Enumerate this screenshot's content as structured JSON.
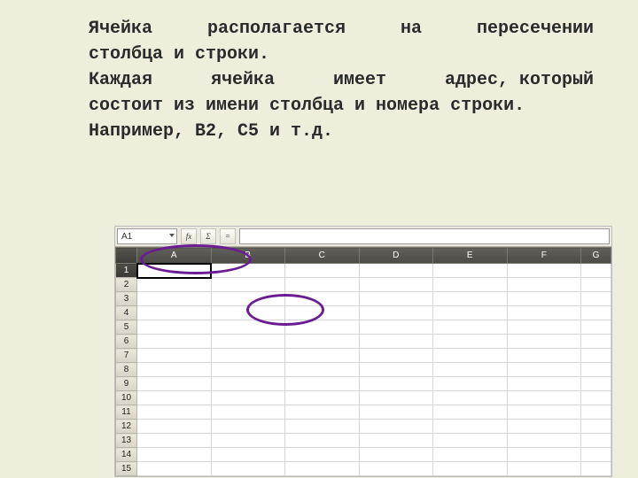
{
  "text": {
    "line1_w1": "Ячейка",
    "line1_w2": "располагается",
    "line1_w3": "на",
    "line1_w4": "пересечении",
    "line2": "столбца и строки.",
    "line3_w1": "Каждая",
    "line3_w2": "ячейка",
    "line3_w3": "имеет",
    "line3_w4": "адрес",
    "line3_w5": ", который",
    "line4": "состоит из имени столбца и номера строки.",
    "line5": "Например, В2, С5 и т.д."
  },
  "spreadsheet": {
    "name_box": "A1",
    "fx_label": "fx",
    "sum_label": "Σ",
    "eq_label": "=",
    "columns": [
      "A",
      "B",
      "C",
      "D",
      "E",
      "F",
      "G"
    ],
    "rows": [
      "1",
      "2",
      "3",
      "4",
      "5",
      "6",
      "7",
      "8",
      "9",
      "10",
      "11",
      "12",
      "13",
      "14",
      "15"
    ]
  }
}
